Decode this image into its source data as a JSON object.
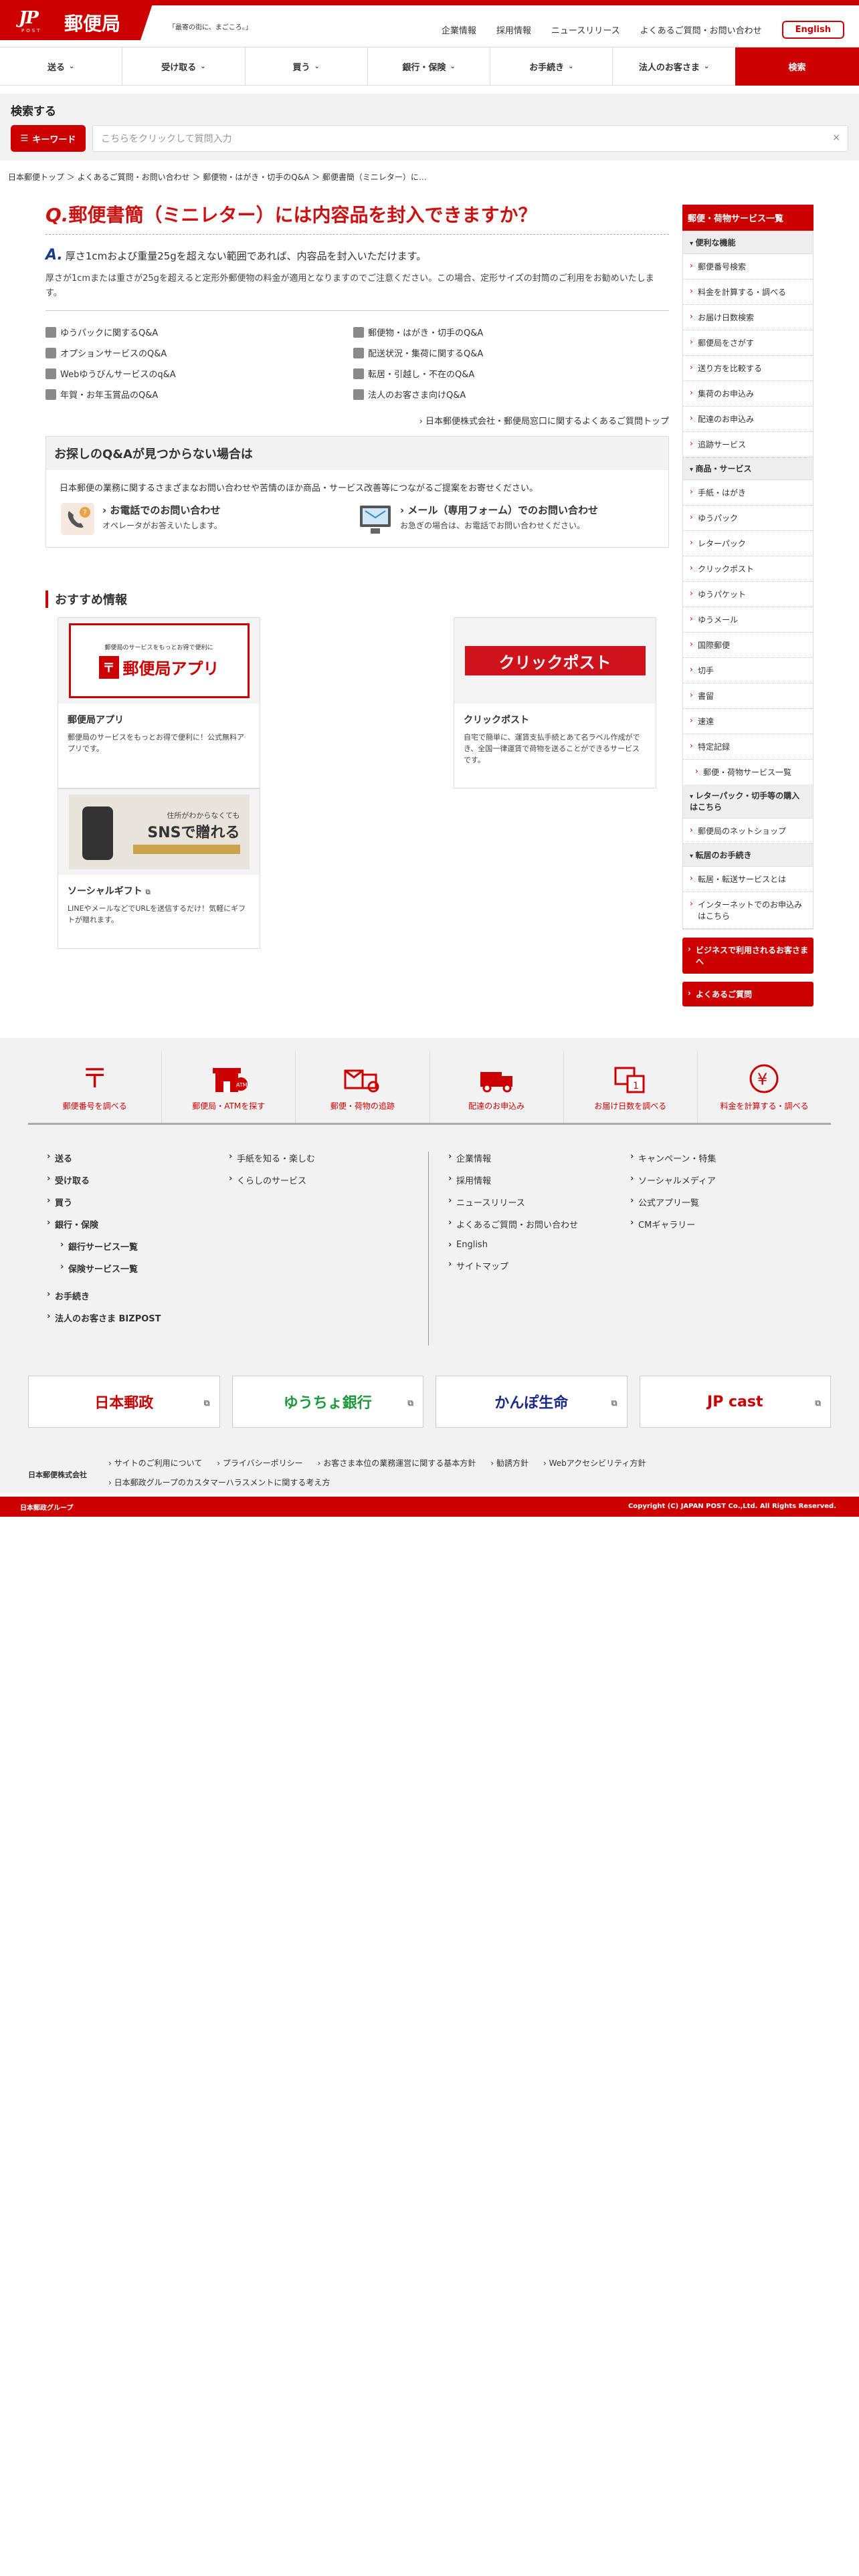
{
  "header": {
    "logo_mark": "JP",
    "logo_sub": "POST",
    "logo_text": "郵便局",
    "tagline": "「最寄の街に、まごころ。」",
    "links": [
      "企業情報",
      "採用情報",
      "ニュースリリース",
      "よくあるご質問・お問い合わせ"
    ],
    "english": "English"
  },
  "nav": {
    "items": [
      "送る",
      "受け取る",
      "買う",
      "銀行・保険",
      "お手続き",
      "法人のお客さま"
    ],
    "search": "検索"
  },
  "search": {
    "title": "検索する",
    "keyword_label": "キーワード",
    "placeholder": "こちらをクリックして質問入力",
    "close": "×"
  },
  "breadcrumb": "日本郵便トップ ＞ よくあるご質問・お問い合わせ ＞ 郵便物・はがき・切手のQ&A ＞ 郵便書簡（ミニレター）に…",
  "question": {
    "q": "Q.",
    "title": "郵便書簡（ミニレター）には内容品を封入できますか？"
  },
  "answer": {
    "a": "A.",
    "text": "厚さ1cmおよび重量25gを超えない範囲であれば、内容品を封入いただけます。",
    "note": "厚さが1cmまたは重さが25gを超えると定形外郵便物の料金が適用となりますのでご注意ください。この場合、定形サイズの封筒のご利用をお勧めいたします。"
  },
  "categories": [
    "ゆうパックに関するQ&A",
    "郵便物・はがき・切手のQ&A",
    "オプションサービスのQ&A",
    "配送状況・集荷に関するQ&A",
    "Webゆうびんサービスのq&A",
    "転居・引越し・不在のQ&A",
    "年賀・お年玉賞品のQ&A",
    "法人のお客さま向けQ&A"
  ],
  "more_link": "日本郵便株式会社・郵便局窓口に関するよくあるご質問トップ",
  "notfound": {
    "title": "お探しのQ&Aが見つからない場合は",
    "desc": "日本郵便の業務に関するさまざまなお問い合わせや苦情のほか商品・サービス改善等につながるご提案をお寄せください。",
    "phone_title": "お電話でのお問い合わせ",
    "phone_sub": "オペレータがお答えいたします。",
    "mail_title": "メール（専用フォーム）でのお問い合わせ",
    "mail_sub": "お急ぎの場合は、お電話でお問い合わせください。"
  },
  "recommend": {
    "title": "おすすめ情報",
    "cards": [
      {
        "title": "郵便局アプリ",
        "desc": "郵便局のサービスをもっとお得で便利に！公式無料アプリです。",
        "img_text": "郵便局アプリ",
        "img_caption": "郵便局のサービスをもっとお得で便利に"
      },
      {
        "title": "クリックポスト",
        "desc": "自宅で簡単に、運賃支払手続とあて名ラベル作成ができ、全国一律運賃で荷物を送ることができるサービスです。",
        "img_text": "クリックポスト"
      },
      {
        "title": "ソーシャルギフト",
        "desc": "LINEやメールなどでURLを送信するだけ！気軽にギフトが贈れます。",
        "img_text": "SNSで贈れる",
        "img_caption": "住所がわからなくても"
      }
    ]
  },
  "sidebar": {
    "head": "郵便・荷物サービス一覧",
    "sections": [
      {
        "title": "便利な機能",
        "items": [
          "郵便番号検索",
          "料金を計算する・調べる",
          "お届け日数検索",
          "郵便局をさがす",
          "送り方を比較する",
          "集荷のお申込み",
          "配達のお申込み",
          "追跡サービス"
        ]
      },
      {
        "title": "商品・サービス",
        "items": [
          "手紙・はがき",
          "ゆうパック",
          "レターパック",
          "クリックポスト",
          "ゆうパケット",
          "ゆうメール",
          "国際郵便",
          "切手",
          "書留",
          "速達",
          "特定記録"
        ],
        "sub": "郵便・荷物サービス一覧"
      },
      {
        "title": "レターパック・切手等の購入はこちら",
        "items": [
          "郵便局のネットショップ"
        ]
      },
      {
        "title": "転居のお手続き",
        "items": [
          "転居・転送サービスとは",
          "インターネットでのお申込みはこちら"
        ]
      }
    ],
    "btn1": "ビジネスで利用されるお客さまへ",
    "btn2": "よくあるご質問"
  },
  "footer": {
    "icons": [
      "郵便番号を調べる",
      "郵便局・ATMを探す",
      "郵便・荷物の追跡",
      "配達のお申込み",
      "お届け日数を調べる",
      "料金を計算する・調べる"
    ],
    "postcode_glyph": "〒",
    "yen_glyph": "¥",
    "col1": [
      "送る",
      "受け取る",
      "買う",
      "銀行・保険",
      "銀行サービス一覧",
      "保険サービス一覧",
      "お手続き",
      "法人のお客さま BIZPOST"
    ],
    "col2": [
      "手紙を知る・楽しむ",
      "くらしのサービス"
    ],
    "col3": [
      "企業情報",
      "採用情報",
      "ニュースリリース",
      "よくあるご質問・お問い合わせ",
      "English",
      "サイトマップ"
    ],
    "col4": [
      "キャンペーン・特集",
      "ソーシャルメディア",
      "公式アプリ一覧",
      "CMギャラリー"
    ],
    "partners": [
      "日本郵政",
      "ゆうちょ銀行",
      "かんぽ生命",
      "JP cast"
    ],
    "org": "日本郵便株式会社",
    "bottom_links": [
      "サイトのご利用について",
      "プライバシーポリシー",
      "お客さま本位の業務運営に関する基本方針",
      "勧誘方針",
      "Webアクセシビリティ方針",
      "日本郵政グループのカスタマーハラスメントに関する考え方"
    ],
    "group": "日本郵政グループ",
    "copyright": "Copyright (C) JAPAN POST Co.,Ltd. All Rights Reserved."
  },
  "colors": {
    "brand_red": "#cc0000",
    "answer_blue": "#1a3a8a"
  }
}
